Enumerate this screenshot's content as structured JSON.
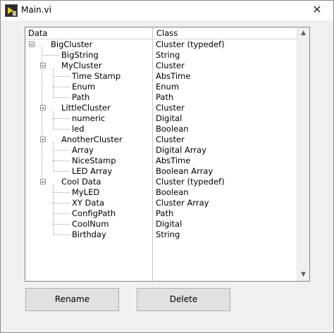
{
  "window": {
    "title": "Main.vi",
    "close_glyph": "✕"
  },
  "tree": {
    "headers": {
      "data": "Data",
      "class": "Class"
    },
    "rows": [
      {
        "label": "BigCluster",
        "class": "Cluster (typedef)"
      },
      {
        "label": "BigString",
        "class": "String"
      },
      {
        "label": "MyCluster",
        "class": "Cluster"
      },
      {
        "label": "Time Stamp",
        "class": "AbsTime"
      },
      {
        "label": "Enum",
        "class": "Enum"
      },
      {
        "label": "Path",
        "class": "Path"
      },
      {
        "label": "LittleCluster",
        "class": "Cluster"
      },
      {
        "label": "numeric",
        "class": "Digital"
      },
      {
        "label": "led",
        "class": "Boolean"
      },
      {
        "label": "AnotherCluster",
        "class": "Cluster"
      },
      {
        "label": "Array",
        "class": "Digital Array"
      },
      {
        "label": "NiceStamp",
        "class": "AbsTime"
      },
      {
        "label": "LED Array",
        "class": "Boolean Array"
      },
      {
        "label": "Cool Data",
        "class": "Cluster (typedef)"
      },
      {
        "label": "MyLED",
        "class": "Boolean"
      },
      {
        "label": "XY Data",
        "class": "Cluster Array"
      },
      {
        "label": "ConfigPath",
        "class": "Path"
      },
      {
        "label": "CoolNum",
        "class": "Digital"
      },
      {
        "label": "Birthday",
        "class": "String"
      }
    ]
  },
  "scrollbar": {
    "up_glyph": "▲",
    "down_glyph": "▼"
  },
  "buttons": {
    "rename": "Rename",
    "delete": "Delete"
  },
  "icons": {
    "app": "labview-vi-icon",
    "close": "close-icon",
    "expander": "collapse-minus-icon"
  }
}
